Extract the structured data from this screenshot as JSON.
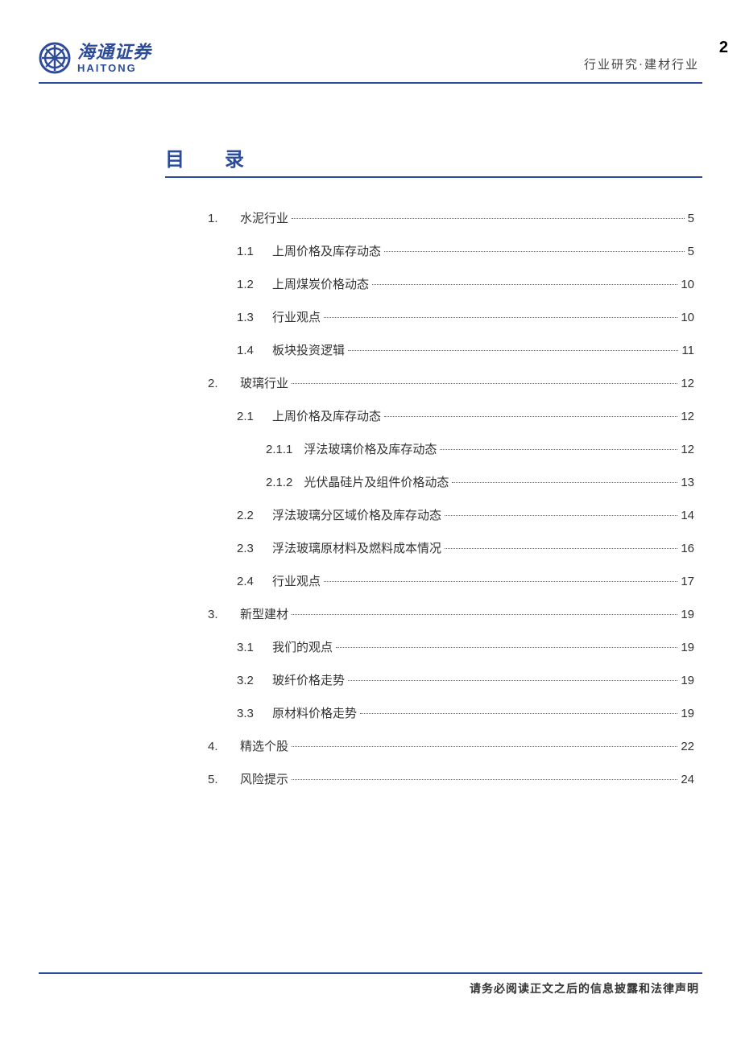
{
  "header": {
    "logo_cn": "海通证券",
    "logo_en": "HAITONG",
    "right_text": "行业研究·建材行业",
    "page_number": "2"
  },
  "section": {
    "title": "目 录"
  },
  "toc": [
    {
      "indent": 0,
      "num": "1.",
      "title": "水泥行业",
      "page": "5"
    },
    {
      "indent": 1,
      "num": "1.1",
      "title": "上周价格及库存动态",
      "page": "5"
    },
    {
      "indent": 1,
      "num": "1.2",
      "title": "上周煤炭价格动态",
      "page": "10"
    },
    {
      "indent": 1,
      "num": "1.3",
      "title": "行业观点",
      "page": "10"
    },
    {
      "indent": 1,
      "num": "1.4",
      "title": "板块投资逻辑",
      "page": "11"
    },
    {
      "indent": 0,
      "num": "2.",
      "title": "玻璃行业",
      "page": "12"
    },
    {
      "indent": 1,
      "num": "2.1",
      "title": "上周价格及库存动态",
      "page": "12"
    },
    {
      "indent": 2,
      "num": "2.1.1",
      "title": "浮法玻璃价格及库存动态",
      "page": "12"
    },
    {
      "indent": 2,
      "num": "2.1.2",
      "title": "光伏晶硅片及组件价格动态",
      "page": "13"
    },
    {
      "indent": 1,
      "num": "2.2",
      "title": "浮法玻璃分区域价格及库存动态",
      "page": "14"
    },
    {
      "indent": 1,
      "num": "2.3",
      "title": "浮法玻璃原材料及燃料成本情况",
      "page": "16"
    },
    {
      "indent": 1,
      "num": "2.4",
      "title": "行业观点",
      "page": "17"
    },
    {
      "indent": 0,
      "num": "3.",
      "title": "新型建材",
      "page": "19"
    },
    {
      "indent": 1,
      "num": "3.1",
      "title": "我们的观点",
      "page": "19"
    },
    {
      "indent": 1,
      "num": "3.2",
      "title": "玻纤价格走势",
      "page": "19"
    },
    {
      "indent": 1,
      "num": "3.3",
      "title": "原材料价格走势",
      "page": "19"
    },
    {
      "indent": 0,
      "num": "4.",
      "title": "精选个股",
      "page": "22"
    },
    {
      "indent": 0,
      "num": "5.",
      "title": "风险提示",
      "page": "24"
    }
  ],
  "footer": {
    "text": "请务必阅读正文之后的信息披露和法律声明"
  }
}
